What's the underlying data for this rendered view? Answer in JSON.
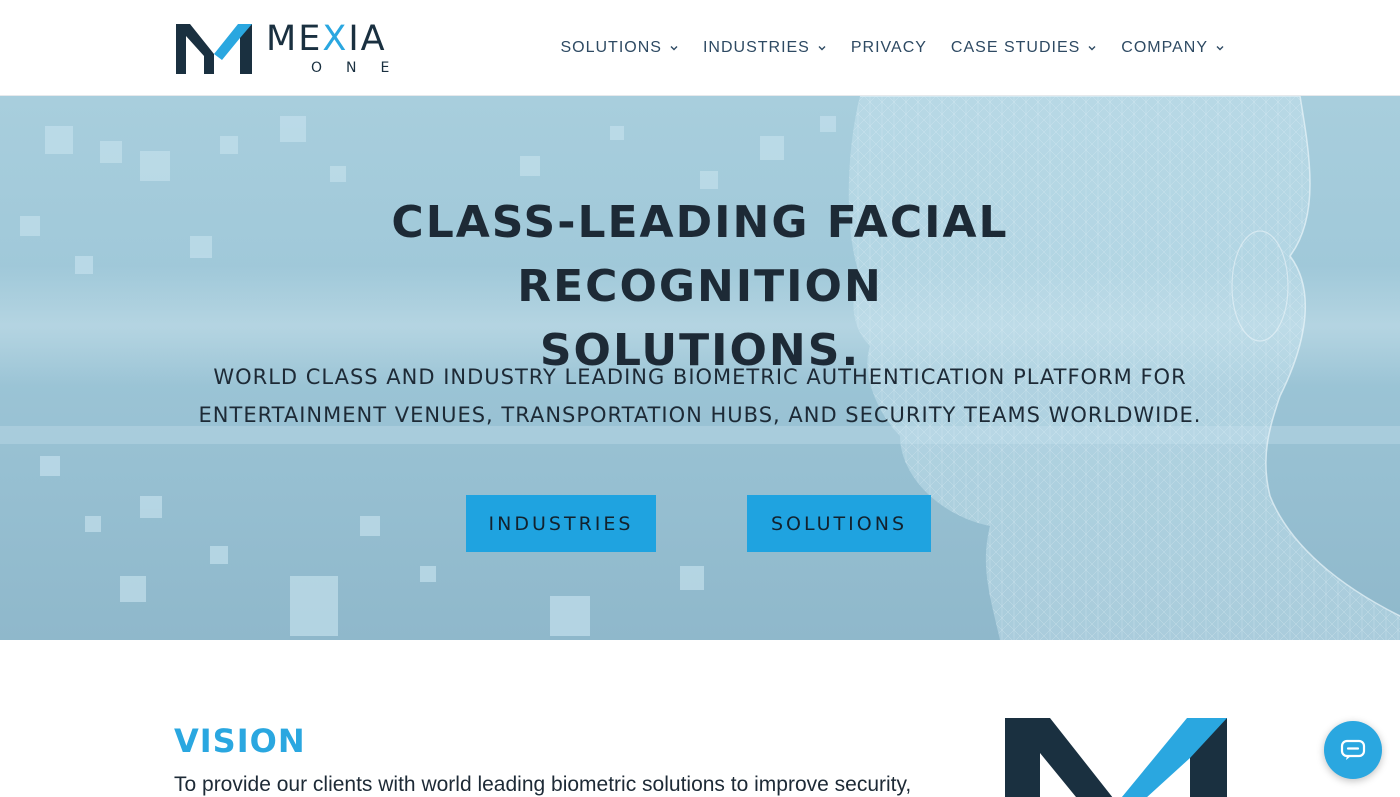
{
  "brand": {
    "name": "MEXIA",
    "sub": "ONE",
    "colors": {
      "navy": "#1a3040",
      "accent": "#2aa7e0"
    }
  },
  "nav": {
    "items": [
      {
        "label": "SOLUTIONS",
        "has_dropdown": true
      },
      {
        "label": "INDUSTRIES",
        "has_dropdown": true
      },
      {
        "label": "PRIVACY",
        "has_dropdown": false
      },
      {
        "label": "CASE STUDIES",
        "has_dropdown": true
      },
      {
        "label": "COMPANY",
        "has_dropdown": true
      }
    ]
  },
  "hero": {
    "title_line1": "CLASS-LEADING FACIAL RECOGNITION",
    "title_line2": "SOLUTIONS.",
    "subtitle_line1": "WORLD CLASS AND INDUSTRY LEADING BIOMETRIC AUTHENTICATION PLATFORM FOR",
    "subtitle_line2": "ENTERTAINMENT VENUES, TRANSPORTATION HUBS, AND SECURITY TEAMS WORLDWIDE.",
    "buttons": {
      "industries": "INDUSTRIES",
      "solutions": "SOLUTIONS"
    },
    "button_color": "#1fa3e0"
  },
  "vision": {
    "title": "VISION",
    "text": "To provide our clients with world leading biometric solutions to improve security,"
  },
  "chat": {
    "icon": "chat-bubble-icon"
  }
}
